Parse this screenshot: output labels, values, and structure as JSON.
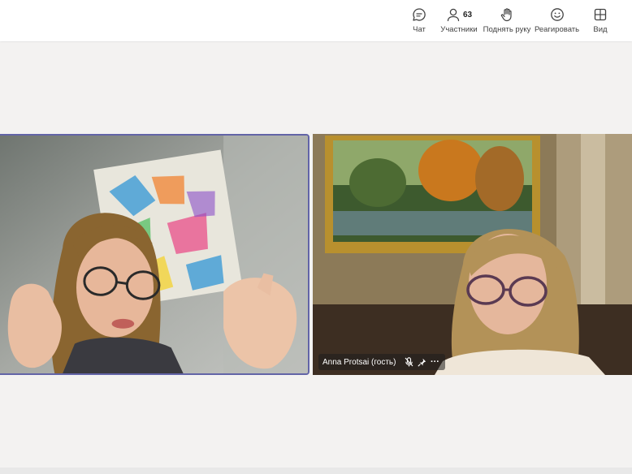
{
  "toolbar": {
    "chat": {
      "label": "Чат",
      "icon": "chat-icon"
    },
    "participants": {
      "label": "Участники",
      "count": "63",
      "icon": "people-icon"
    },
    "raise_hand": {
      "label": "Поднять руку",
      "icon": "hand-icon"
    },
    "react": {
      "label": "Реагировать",
      "icon": "smile-icon"
    },
    "view": {
      "label": "Вид",
      "icon": "grid-icon"
    }
  },
  "tiles": [
    {
      "active": true,
      "accent": "#6264a7"
    },
    {
      "participant_name": "Anna Protsai (гость)",
      "muted": true,
      "pinned": true,
      "more": "···"
    }
  ]
}
